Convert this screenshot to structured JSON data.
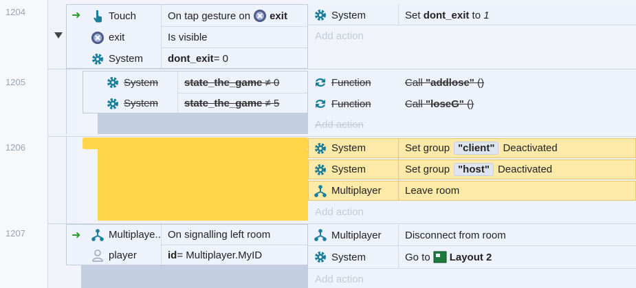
{
  "events": [
    {
      "number": "1204",
      "conditions": [
        {
          "object": "Touch",
          "text": "On tap gesture on ",
          "target": "exit"
        },
        {
          "object": "exit",
          "text": "Is visible"
        },
        {
          "object": "System",
          "bold": "dont_exit",
          "text": " = 0"
        }
      ],
      "actions": [
        {
          "object": "System",
          "text": "Set ",
          "bold": "dont_exit",
          "suffix": " to ",
          "value": "1"
        }
      ],
      "add_action": "Add action"
    },
    {
      "number": "1205",
      "conditions": [
        {
          "object": "System",
          "bold": "state_the_game",
          "text": " ≠ 0"
        },
        {
          "object": "System",
          "bold": "state_the_game",
          "text": " ≠ 5"
        }
      ],
      "actions": [
        {
          "object": "Function",
          "text": "Call ",
          "bold": "\"addlose\"",
          "suffix": " ()"
        },
        {
          "object": "Function",
          "text": "Call ",
          "bold": "\"loseG\"",
          "suffix": " ()"
        }
      ],
      "add_action": "Add action"
    },
    {
      "number": "1206",
      "actions": [
        {
          "object": "System",
          "text": "Set group",
          "pill": "\"client\"",
          "suffix": "Deactivated"
        },
        {
          "object": "System",
          "text": "Set group",
          "pill": "\"host\"",
          "suffix": "Deactivated"
        },
        {
          "object": "Multiplayer",
          "text": "Leave room"
        }
      ],
      "add_action": "Add action"
    },
    {
      "number": "1207",
      "conditions": [
        {
          "object": "Multiplaye...",
          "text": "On signalling left room"
        },
        {
          "object": "player",
          "bold": "id",
          "text": " = Multiplayer.MyID"
        }
      ],
      "actions": [
        {
          "object": "Multiplayer",
          "text": "Disconnect from room"
        },
        {
          "object": "System",
          "text": "Go to ",
          "layout": "Layout 2"
        }
      ],
      "add_action": "Add action"
    }
  ],
  "colors": {
    "accent": "#1a7f9a",
    "trigger_arrow": "#2e9a2e",
    "selected_yellow": "#ffd54a"
  }
}
